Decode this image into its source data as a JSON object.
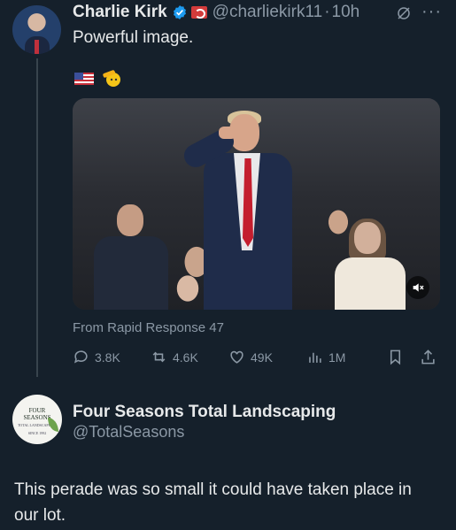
{
  "tweet": {
    "author_name": "Charlie Kirk",
    "handle": "@charliekirk11",
    "separator": "·",
    "time": "10h",
    "text": "Powerful image.",
    "emoji_icons": [
      "us-flag-emoji",
      "saluting-face-emoji"
    ],
    "media_source": "From Rapid Response 47",
    "stats": {
      "replies": "3.8K",
      "reposts": "4.6K",
      "likes": "49K",
      "views": "1M"
    }
  },
  "reply": {
    "author_name": "Four Seasons Total Landscaping",
    "handle": "@TotalSeasons",
    "text": "This perade was so small it could have taken place in our lot.",
    "avatar_logo_text": "FOUR SEASONS",
    "avatar_logo_sub": "TOTAL LANDSCAPING · SINCE 1992"
  },
  "colors": {
    "background": "#15202b",
    "text": "#e7e9ea",
    "muted": "#8b98a5",
    "verified": "#1d9bf0"
  }
}
